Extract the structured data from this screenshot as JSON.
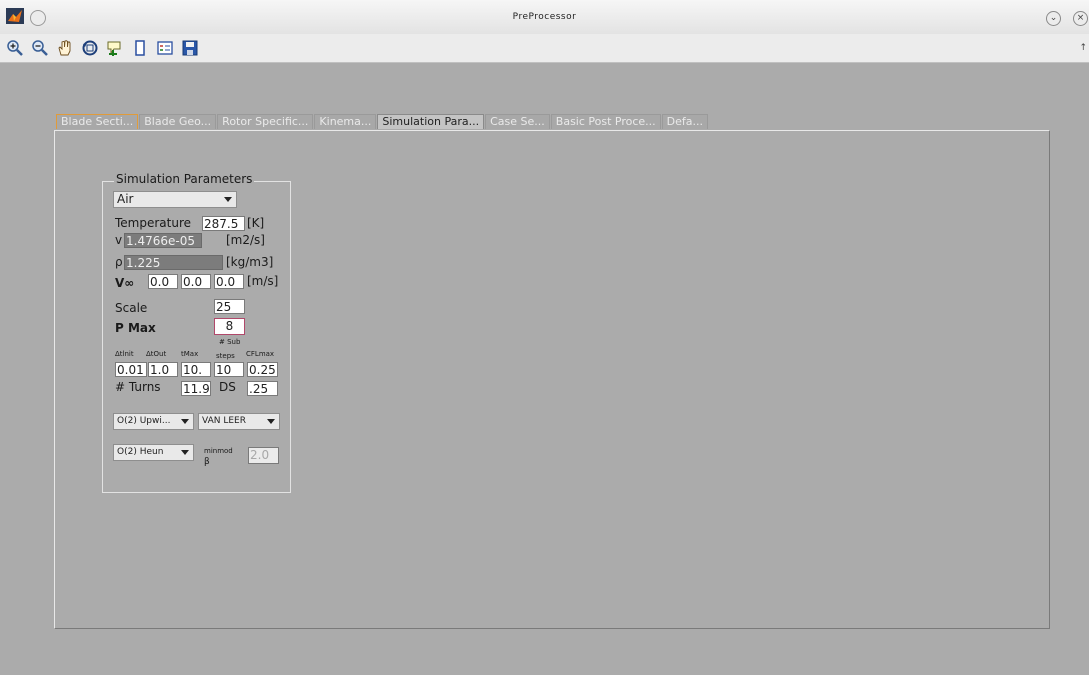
{
  "window": {
    "title": "PreProcessor"
  },
  "toolbar": {
    "icons": [
      "zoom-in-icon",
      "zoom-out-icon",
      "pan-hand-icon",
      "rotate-3d-icon",
      "data-cursor-icon",
      "insert-colorbar-icon",
      "insert-legend-icon",
      "save-icon"
    ]
  },
  "tabs": [
    {
      "label": "Blade Secti...",
      "state": "focused"
    },
    {
      "label": "Blade Geo...",
      "state": "normal"
    },
    {
      "label": "Rotor Specific...",
      "state": "normal"
    },
    {
      "label": "Kinema...",
      "state": "normal"
    },
    {
      "label": "Simulation Para...",
      "state": "selected"
    },
    {
      "label": "Case Se...",
      "state": "normal"
    },
    {
      "label": "Basic Post Proce...",
      "state": "normal"
    },
    {
      "label": "Defa...",
      "state": "normal"
    }
  ],
  "sim": {
    "group_title": "Simulation Parameters",
    "fluid": "Air",
    "temperature_label": "Temperature",
    "temperature_value": "287.5",
    "temperature_unit": "[K]",
    "nu_label": "v",
    "nu_value": "1.4766e-05",
    "nu_unit": "[m2/s]",
    "rho_label": "ρ",
    "rho_value": "1.225",
    "rho_unit": "[kg/m3]",
    "vinf_label": "V∞",
    "vinf_values": [
      "0.0",
      "0.0",
      "0.0"
    ],
    "vinf_unit": "[m/s]",
    "scale_label": "Scale",
    "scale_value": "25",
    "pmax_label": "P Max",
    "pmax_value": "8",
    "col_labels": {
      "dtinit": "Δtlnit",
      "dtout": "ΔtOut",
      "tmax": "tMax",
      "substeps_1": "# Sub",
      "substeps_2": "steps",
      "cflmax": "CFLmax"
    },
    "col_values": {
      "dtinit": "0.01",
      "dtout": "1.0",
      "tmax": "10.",
      "substeps": "10",
      "cflmax": "0.25"
    },
    "turns_label": "# Turns",
    "turns_value": "11.9",
    "ds_label": "DS",
    "ds_value": ".25",
    "spatial_scheme": "O(2) Upwi...",
    "limiter": "VAN LEER",
    "time_scheme": "O(2) Heun",
    "minmod_label": "minmod",
    "beta_label": "β",
    "beta_value": "2.0"
  },
  "colors": {
    "background": "#ababab",
    "focus_border": "#e09b3a",
    "field_selected_border": "#b0486a"
  }
}
